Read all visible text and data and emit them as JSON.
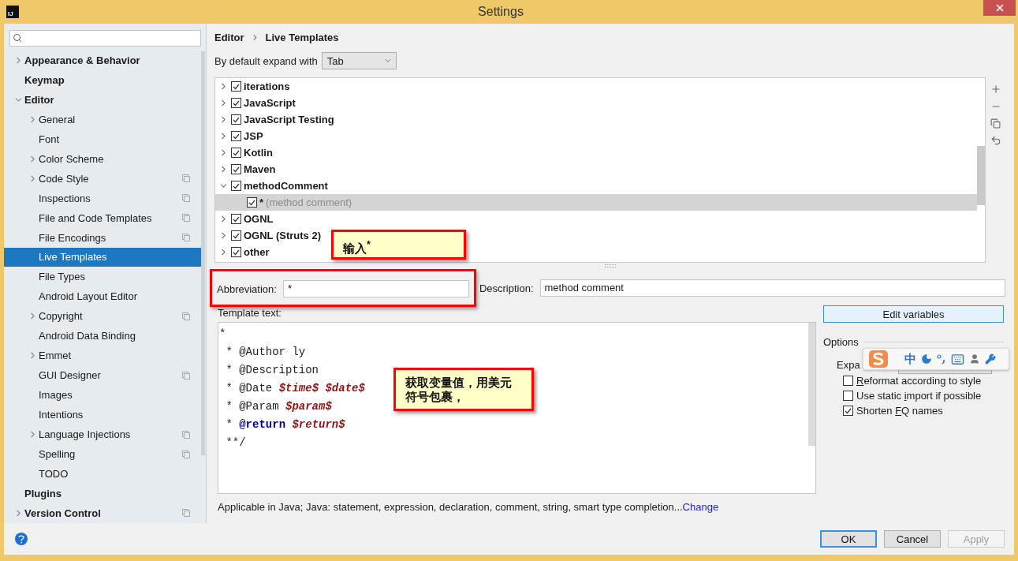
{
  "window": {
    "title": "Settings",
    "app_icon_text": "IJ"
  },
  "sidebar": {
    "items": [
      {
        "label": "Appearance & Behavior",
        "expandable": true,
        "expanded": false,
        "selected": false,
        "scope_icon": false
      },
      {
        "label": "Keymap",
        "expandable": false,
        "expanded": false,
        "selected": false,
        "scope_icon": false
      },
      {
        "label": "Editor",
        "expandable": true,
        "expanded": true,
        "selected": false,
        "scope_icon": false,
        "children": [
          {
            "label": "General",
            "expandable": true,
            "expanded": false,
            "selected": false,
            "scope_icon": false
          },
          {
            "label": "Font",
            "expandable": false,
            "expanded": false,
            "selected": false,
            "scope_icon": false
          },
          {
            "label": "Color Scheme",
            "expandable": true,
            "expanded": false,
            "selected": false,
            "scope_icon": false
          },
          {
            "label": "Code Style",
            "expandable": true,
            "expanded": false,
            "selected": false,
            "scope_icon": true
          },
          {
            "label": "Inspections",
            "expandable": false,
            "expanded": false,
            "selected": false,
            "scope_icon": true
          },
          {
            "label": "File and Code Templates",
            "expandable": false,
            "expanded": false,
            "selected": false,
            "scope_icon": true
          },
          {
            "label": "File Encodings",
            "expandable": false,
            "expanded": false,
            "selected": false,
            "scope_icon": true
          },
          {
            "label": "Live Templates",
            "expandable": false,
            "expanded": false,
            "selected": true,
            "scope_icon": false
          },
          {
            "label": "File Types",
            "expandable": false,
            "expanded": false,
            "selected": false,
            "scope_icon": false
          },
          {
            "label": "Android Layout Editor",
            "expandable": false,
            "expanded": false,
            "selected": false,
            "scope_icon": false
          },
          {
            "label": "Copyright",
            "expandable": true,
            "expanded": false,
            "selected": false,
            "scope_icon": true
          },
          {
            "label": "Android Data Binding",
            "expandable": false,
            "expanded": false,
            "selected": false,
            "scope_icon": false
          },
          {
            "label": "Emmet",
            "expandable": true,
            "expanded": false,
            "selected": false,
            "scope_icon": false
          },
          {
            "label": "GUI Designer",
            "expandable": false,
            "expanded": false,
            "selected": false,
            "scope_icon": true
          },
          {
            "label": "Images",
            "expandable": false,
            "expanded": false,
            "selected": false,
            "scope_icon": false
          },
          {
            "label": "Intentions",
            "expandable": false,
            "expanded": false,
            "selected": false,
            "scope_icon": false
          },
          {
            "label": "Language Injections",
            "expandable": true,
            "expanded": false,
            "selected": false,
            "scope_icon": true
          },
          {
            "label": "Spelling",
            "expandable": false,
            "expanded": false,
            "selected": false,
            "scope_icon": true
          },
          {
            "label": "TODO",
            "expandable": false,
            "expanded": false,
            "selected": false,
            "scope_icon": false
          }
        ]
      },
      {
        "label": "Plugins",
        "expandable": false,
        "expanded": false,
        "selected": false,
        "scope_icon": false
      },
      {
        "label": "Version Control",
        "expandable": true,
        "expanded": false,
        "selected": false,
        "scope_icon": true
      }
    ]
  },
  "breadcrumb": [
    "Editor",
    "Live Templates"
  ],
  "expand_with": {
    "label": "By default expand with",
    "value": "Tab"
  },
  "templates": [
    {
      "label": "iterations",
      "checked": true,
      "expanded": false,
      "selected": false
    },
    {
      "label": "JavaScript",
      "checked": true,
      "expanded": false,
      "selected": false
    },
    {
      "label": "JavaScript Testing",
      "checked": true,
      "expanded": false,
      "selected": false
    },
    {
      "label": "JSP",
      "checked": true,
      "expanded": false,
      "selected": false
    },
    {
      "label": "Kotlin",
      "checked": true,
      "expanded": false,
      "selected": false
    },
    {
      "label": "Maven",
      "checked": true,
      "expanded": false,
      "selected": false
    },
    {
      "label": "methodComment",
      "checked": true,
      "expanded": true,
      "selected": false,
      "children": [
        {
          "abbreviation": "*",
          "description": "(method comment)",
          "checked": true,
          "selected": true
        }
      ]
    },
    {
      "label": "OGNL",
      "checked": true,
      "expanded": false,
      "selected": false
    },
    {
      "label": "OGNL (Struts 2)",
      "checked": true,
      "expanded": false,
      "selected": false
    },
    {
      "label": "other",
      "checked": true,
      "expanded": false,
      "selected": false
    }
  ],
  "abbreviation": {
    "label": "Abbreviation:",
    "value": "*"
  },
  "description": {
    "label": "Description:",
    "value": "method comment"
  },
  "template_text": {
    "label": "Template text:",
    "lines": [
      [
        {
          "text": "*",
          "kind": "plain"
        }
      ],
      [
        {
          "text": " * @Author ly",
          "kind": "plain"
        }
      ],
      [
        {
          "text": " * @Description",
          "kind": "plain"
        }
      ],
      [
        {
          "text": " * @Date ",
          "kind": "plain"
        },
        {
          "text": "$time$ ",
          "kind": "variable"
        },
        {
          "text": "$date$",
          "kind": "variable"
        }
      ],
      [
        {
          "text": " * @Param ",
          "kind": "plain"
        },
        {
          "text": "$param$",
          "kind": "variable"
        }
      ],
      [
        {
          "text": " * ",
          "kind": "plain"
        },
        {
          "text": "@return ",
          "kind": "keyword"
        },
        {
          "text": "$return$",
          "kind": "variable"
        }
      ],
      [
        {
          "text": " **/",
          "kind": "plain"
        }
      ]
    ]
  },
  "edit_variables": "Edit variables",
  "options": {
    "title": "Options",
    "expand_label": "Expa",
    "checkboxes": [
      {
        "mnemonic": "R",
        "rest": "eformat according to style",
        "checked": false
      },
      {
        "before": "Use static ",
        "mnemonic": "i",
        "rest": "mport if possible",
        "checked": false
      },
      {
        "before": "Shorten ",
        "mnemonic": "F",
        "rest": "Q names",
        "checked": true
      }
    ]
  },
  "applicable": {
    "text": "Applicable in Java; Java: statement, expression, declaration, comment, string, smart type completion...",
    "link": "Change"
  },
  "buttons": [
    {
      "label": "OK",
      "default": true,
      "disabled": false
    },
    {
      "label": "Cancel",
      "default": false,
      "disabled": false
    },
    {
      "label": "Apply",
      "default": false,
      "disabled": true
    }
  ],
  "callouts": [
    "输入$^{*}$",
    "获取变量值，用美元符号包裹，"
  ],
  "ime_bar": {
    "mode": "中"
  }
}
